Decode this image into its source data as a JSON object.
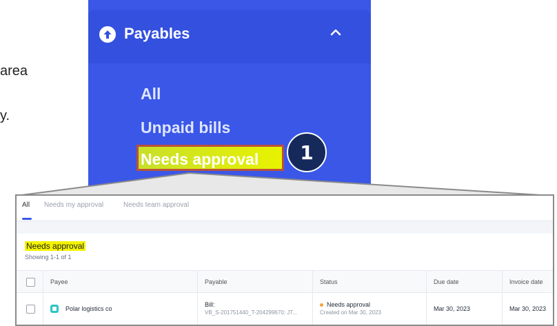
{
  "background_text": {
    "line1": "area",
    "line2": "y."
  },
  "sidebar": {
    "title": "Payables",
    "items": [
      {
        "label": "All"
      },
      {
        "label": "Unpaid bills"
      },
      {
        "label": "Needs approval",
        "active": true
      }
    ],
    "step_badge": "1"
  },
  "colors": {
    "sidebar_bg": "#3a57e8",
    "highlight": "#e8f200",
    "badge": "#152a5b"
  },
  "tabs": [
    {
      "label": "All",
      "active": true
    },
    {
      "label": "Needs my approval"
    },
    {
      "label": "Needs team approval"
    }
  ],
  "section": {
    "title": "Needs approval",
    "subtitle": "Showing 1-1 of 1"
  },
  "table": {
    "columns": [
      "Payee",
      "Payable",
      "Status",
      "Due date",
      "Invoice date"
    ],
    "rows": [
      {
        "payee": "Polar logistics co",
        "payable_type": "Bill:",
        "payable_ref": "VB_S-201751440_T-204299670: JT...",
        "status": "Needs approval",
        "status_sub": "Created on Mar 30, 2023",
        "due_date": "Mar 30, 2023",
        "invoice_date": "Mar 30, 2023"
      }
    ]
  }
}
